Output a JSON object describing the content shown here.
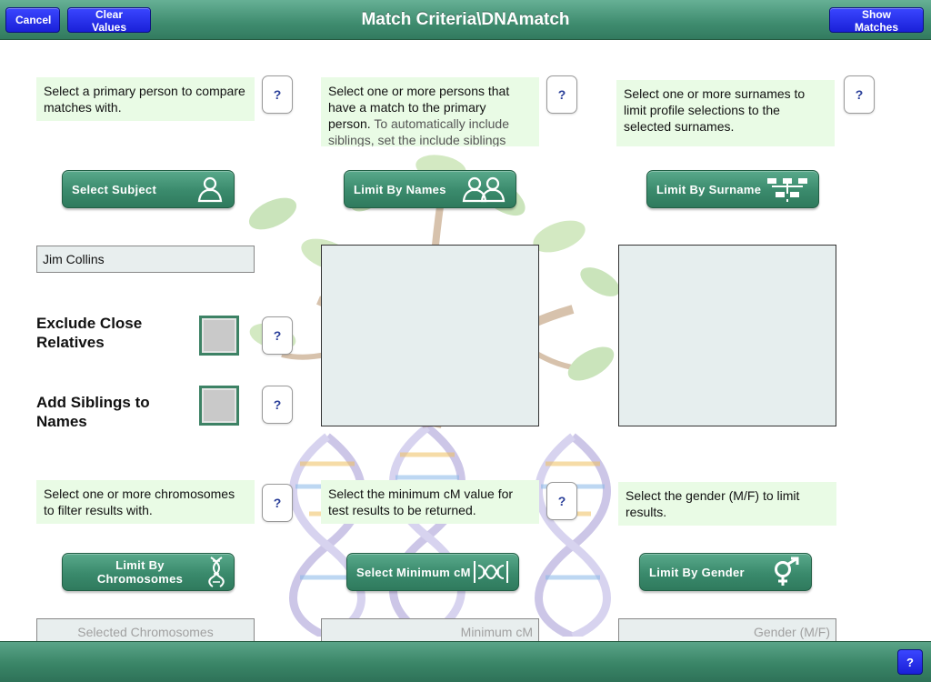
{
  "header": {
    "title": "Match Criteria\\DNAmatch",
    "cancel_label": "Cancel",
    "clear_label": "Clear Values",
    "show_matches_label": "Show Matches"
  },
  "help_label": "?",
  "info": {
    "subject": "Select a primary person to compare matches with.",
    "names_main": "Select one or more persons that have a match to the primary person.",
    "names_sub": " To automatically include siblings, set the include siblings",
    "surname": "Select one or more surnames to limit profile selections to the selected surnames.",
    "chromosomes": "Select one or more chromosomes to filter results with.",
    "min_cm": "Select the minimum cM value for test results to be returned.",
    "gender": "Select the gender (M/F) to limit results."
  },
  "buttons": {
    "select_subject": "Select Subject",
    "limit_names": "Limit By Names",
    "limit_surname": "Limit By Surname",
    "limit_chromosomes": "Limit By Chromosomes",
    "select_min_cm": "Select Minimum cM",
    "limit_gender": "Limit By Gender"
  },
  "subject": {
    "value": "Jim Collins"
  },
  "options": {
    "exclude_close": "Exclude Close Relatives",
    "add_siblings": "Add Siblings to Names"
  },
  "fields": {
    "chromosomes_placeholder": "Selected Chromosomes",
    "min_cm_placeholder": "Minimum cM",
    "gender_placeholder": "Gender (M/F)"
  },
  "icons": {
    "subject": "person-icon",
    "names": "people-icon",
    "surname": "tree-icon",
    "chromosomes": "dna-icon",
    "min_cm": "dna-segment-icon",
    "gender": "gender-icon"
  },
  "colors": {
    "bar_green": "#3f8c6f",
    "button_green": "#3a8a6c",
    "nav_blue": "#1a20d8",
    "info_bg": "#e9fbe5"
  }
}
